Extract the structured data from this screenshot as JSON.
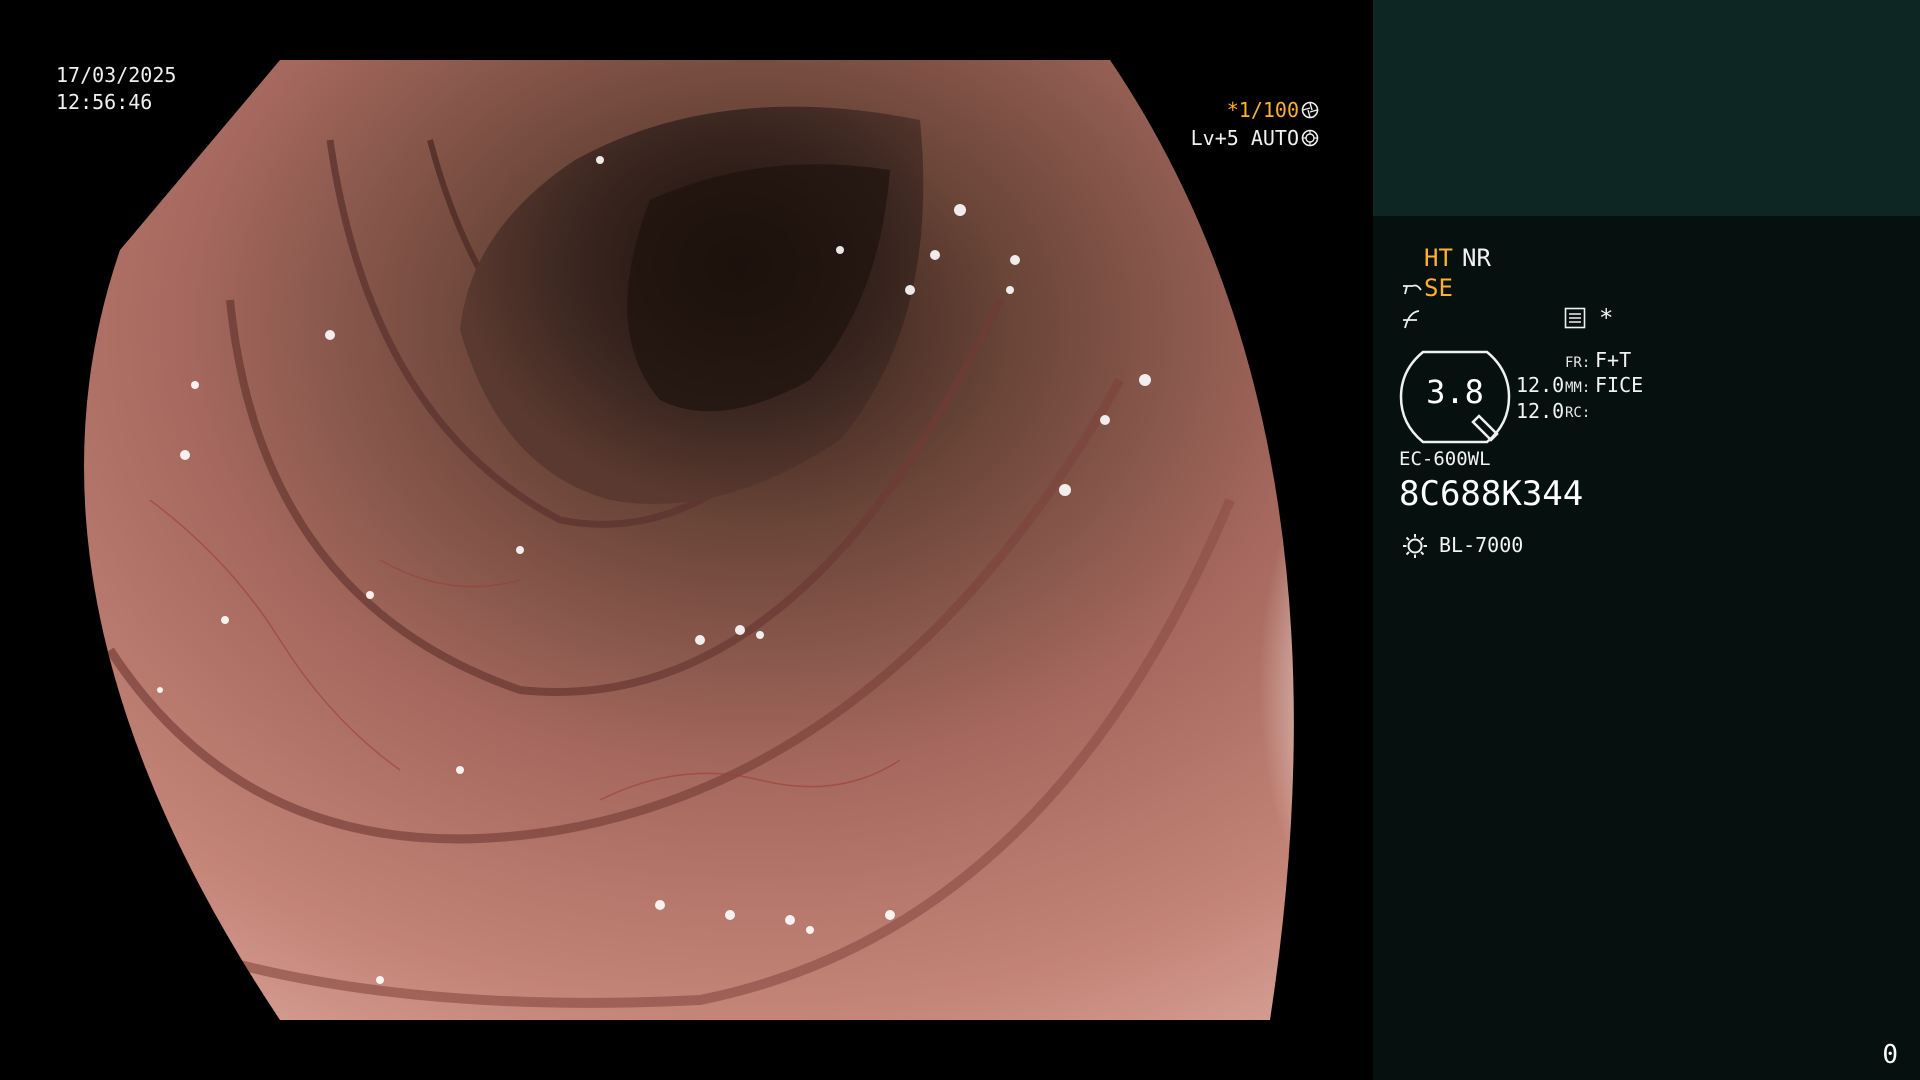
{
  "overlay": {
    "date": "17/03/2025",
    "time": "12:56:46",
    "shutter": "*1/100",
    "shutter_icon": "aperture-icon",
    "level": "Lv+5 AUTO",
    "level_icon": "iris-icon"
  },
  "panel": {
    "ht": "HT",
    "nr": "NR",
    "se": "SE",
    "se_icon": "structure-enhance-icon",
    "enhance_icon": "enhance-curve-icon",
    "menu_icon": "menu-icon",
    "star": "*",
    "zoom": "3.8",
    "val1": "12.0",
    "val2": "12.0",
    "fr_label": "FR:",
    "fr_value": "F+T",
    "mm_label": "MM:",
    "mm_value": "FICE",
    "rc_label": "RC:",
    "model": "EC-600WL",
    "serial": "8C688K344",
    "light_icon": "light-source-icon",
    "light": "BL-7000",
    "page": "0"
  },
  "colors": {
    "amber": "#ffb030",
    "panel_bg": "#06110f",
    "panel_top_bg": "#0d2623"
  }
}
